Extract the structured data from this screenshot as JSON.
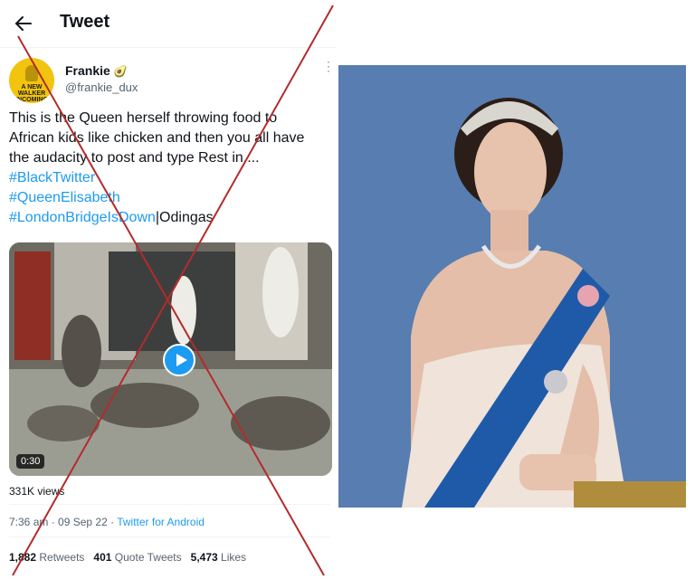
{
  "header": {
    "title": "Tweet",
    "back_icon": "arrow-left-icon"
  },
  "author": {
    "display_name": "Frankie",
    "badge_emoji": "🥑",
    "handle": "@frankie_dux",
    "avatar_text": "A NEW WALKER INCOMING",
    "more_icon": "more-vertical-icon"
  },
  "tweet": {
    "lines": [
      "This is the Queen herself throwing food to",
      "African kids like chicken and then you all have",
      "the audacity to post and type Rest in...."
    ],
    "hashtags": [
      "#BlackTwitter",
      "#QueenElisabeth",
      "#LondonBridgeIsDown"
    ],
    "trailing_text": "|Odingas"
  },
  "media": {
    "duration": "0:30",
    "play_icon": "play-icon"
  },
  "views": "331K views",
  "meta": {
    "time": "7:36 am",
    "separator": " · ",
    "date": "09 Sep 22",
    "source_separator": " · ",
    "source": "Twitter for Android"
  },
  "stats": {
    "retweets_count": "1,882",
    "retweets_label": "Retweets",
    "quotes_count": "401",
    "quotes_label": "Quote Tweets",
    "likes_count": "5,473",
    "likes_label": "Likes"
  },
  "colors": {
    "cross": "#b22c2c",
    "link": "#1d9bf0",
    "photo_bg": "#5c83b5",
    "sash": "#1f5aa8"
  }
}
